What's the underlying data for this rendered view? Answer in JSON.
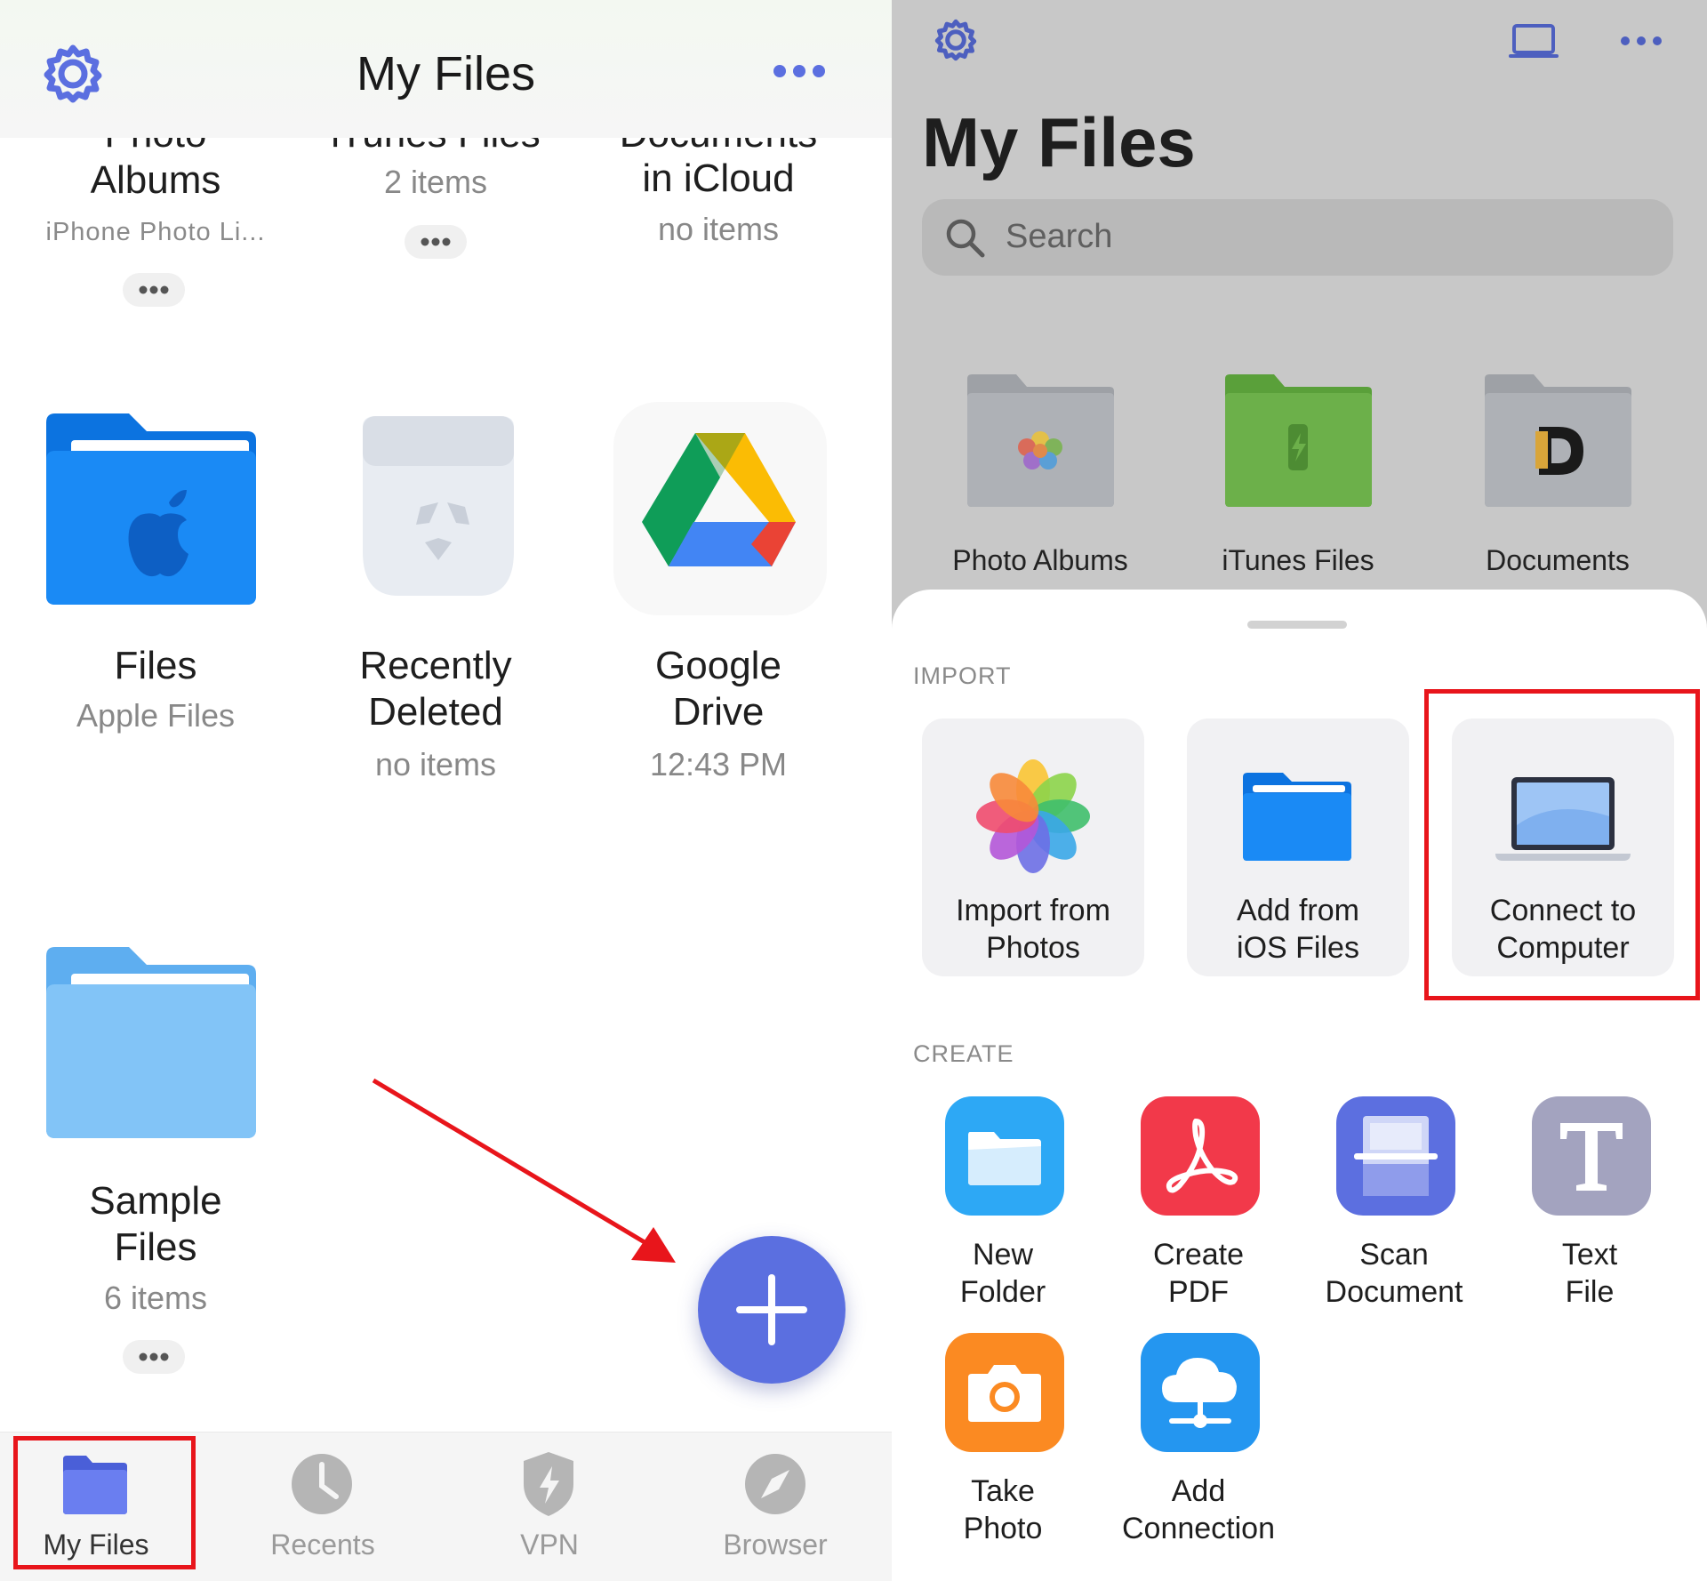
{
  "left_panel": {
    "header": {
      "title": "My Files"
    },
    "top_row": [
      {
        "name": "Albums",
        "clipped_name": "Photo",
        "subtitle": "iPhone Photo Li..."
      },
      {
        "name": "iTunes Files",
        "subtitle": "2 items"
      },
      {
        "name": "in iCloud",
        "clipped_name": "Documents",
        "subtitle": "no items"
      }
    ],
    "items": [
      {
        "name": "Files",
        "subtitle": "Apple Files"
      },
      {
        "name_line1": "Recently",
        "name_line2": "Deleted",
        "subtitle": "no items"
      },
      {
        "name_line1": "Google",
        "name_line2": "Drive",
        "subtitle": "12:43 PM"
      },
      {
        "name_line1": "Sample",
        "name_line2": "Files",
        "subtitle": "6 items"
      }
    ],
    "tabs": [
      {
        "label": "My Files",
        "active": true
      },
      {
        "label": "Recents"
      },
      {
        "label": "VPN"
      },
      {
        "label": "Browser"
      }
    ]
  },
  "right_panel": {
    "title": "My Files",
    "search_placeholder": "Search",
    "folders": [
      {
        "label": "Photo Albums"
      },
      {
        "label": "iTunes Files"
      },
      {
        "label": "Documents"
      }
    ],
    "sheet": {
      "import_header": "IMPORT",
      "import_items": [
        {
          "line1": "Import from",
          "line2": "Photos"
        },
        {
          "line1": "Add from",
          "line2": "iOS Files"
        },
        {
          "line1": "Connect to",
          "line2": "Computer"
        }
      ],
      "create_header": "CREATE",
      "create_items": [
        {
          "line1": "New",
          "line2": "Folder",
          "color": "#2da8f5"
        },
        {
          "line1": "Create",
          "line2": "PDF",
          "color": "#f2394a"
        },
        {
          "line1": "Scan",
          "line2": "Document",
          "color": "#5c6fe0"
        },
        {
          "line1": "Text",
          "line2": "File",
          "color": "#a3a3bf"
        },
        {
          "line1": "Take",
          "line2": "Photo",
          "color": "#fb8a22"
        },
        {
          "line1": "Add",
          "line2": "Connection",
          "color": "#2496f0"
        }
      ]
    }
  },
  "accent_colors": {
    "primary": "#5b6fe0",
    "highlight": "#e8151b"
  }
}
